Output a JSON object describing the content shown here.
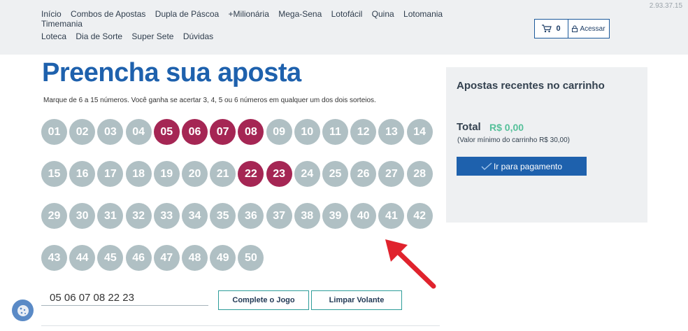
{
  "version": "2.93.37.15",
  "nav": {
    "row1": [
      "Início",
      "Combos de Apostas",
      "Dupla de Páscoa",
      "+Milionária",
      "Mega-Sena",
      "Lotofácil",
      "Quina",
      "Lotomania",
      "Timemania"
    ],
    "row2": [
      "Loteca",
      "Dia de Sorte",
      "Super Sete",
      "Dúvidas"
    ]
  },
  "cart": {
    "count": "0",
    "icon": "cart-icon",
    "login_label": "Acessar",
    "login_icon": "lock-icon"
  },
  "page": {
    "title": "Preencha sua aposta",
    "instructions": "Marque de 6 a 15 números. Você ganha se acertar 3, 4, 5 ou 6 números em qualquer um dos dois sorteios."
  },
  "numbers": [
    "01",
    "02",
    "03",
    "04",
    "05",
    "06",
    "07",
    "08",
    "09",
    "10",
    "11",
    "12",
    "13",
    "14",
    "15",
    "16",
    "17",
    "18",
    "19",
    "20",
    "21",
    "22",
    "23",
    "24",
    "25",
    "26",
    "27",
    "28",
    "29",
    "30",
    "31",
    "32",
    "33",
    "34",
    "35",
    "36",
    "37",
    "38",
    "39",
    "40",
    "41",
    "42",
    "43",
    "44",
    "45",
    "46",
    "47",
    "48",
    "49",
    "50"
  ],
  "selected": [
    "05",
    "06",
    "07",
    "08",
    "22",
    "23"
  ],
  "selected_display": "05 06 07 08 22 23",
  "buttons": {
    "complete": "Complete o Jogo",
    "clear": "Limpar Volante"
  },
  "panel": {
    "title": "Apostas recentes no carrinho",
    "total_label": "Total",
    "total_value": "R$ 0,00",
    "min_note": "(Valor mínimo do carrinho R$ 30,00)",
    "pay_label": "Ir para pagamento"
  },
  "colors": {
    "selected_ball": "#a52654",
    "ball": "#b0c0c4",
    "brand": "#1e61ad",
    "total": "#56c09a",
    "arrow": "#e0232d"
  }
}
